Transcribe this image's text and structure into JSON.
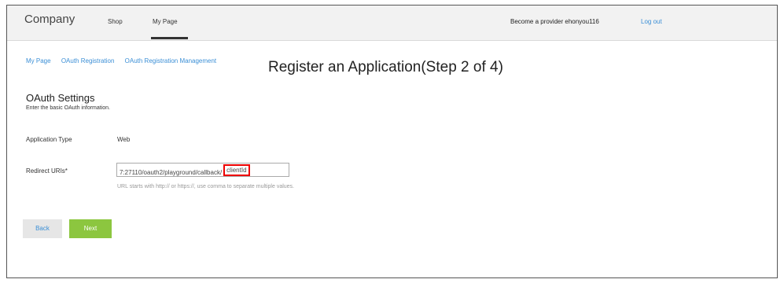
{
  "header": {
    "brand": "Company",
    "nav": [
      "Shop",
      "My Page"
    ],
    "provider": "Become a provider  ehonyou116",
    "logout": "Log out"
  },
  "breadcrumb": [
    "My Page",
    "OAuth Registration",
    "OAuth Registration Management"
  ],
  "page_title": "Register an Application(Step 2 of 4)",
  "section": {
    "title": "OAuth Settings",
    "subtitle": "Enter the basic OAuth information."
  },
  "form": {
    "app_type_label": "Application Type",
    "app_type_value": "Web",
    "redirect_label": "Redirect URIs*",
    "redirect_value": "7:27110/oauth2/playground/callback/",
    "redirect_highlight": "clientId",
    "redirect_help": "URL starts with http:// or https://, use comma to separate multiple values."
  },
  "buttons": {
    "back": "Back",
    "next": "Next"
  },
  "colors": {
    "link": "#3b8fd6",
    "next_button": "#8cc63f",
    "highlight_border": "#e00000"
  }
}
